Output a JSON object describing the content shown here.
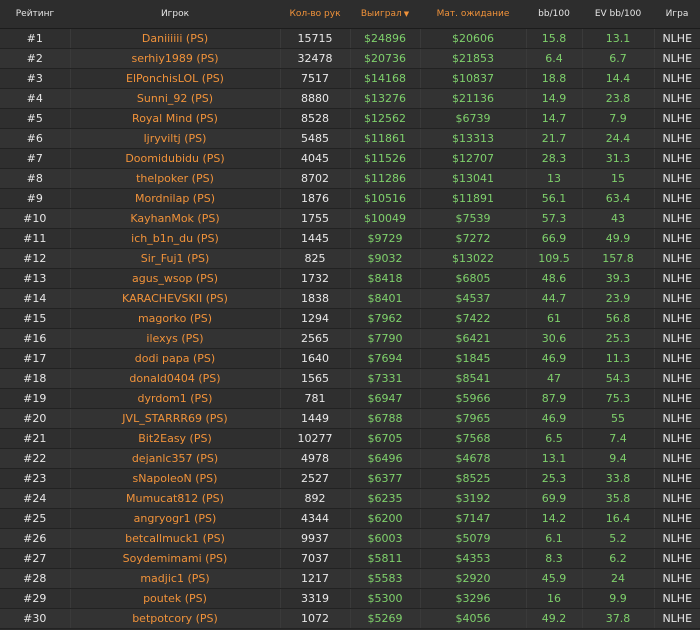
{
  "headers": {
    "rank": "Рейтинг",
    "player": "Игрок",
    "hands": "Кол-во рук",
    "won": "Выиграл",
    "won_arrow": "▼",
    "ev": "Мат. ожидание",
    "bb100": "bb/100",
    "evbb100": "EV bb/100",
    "game": "Игра"
  },
  "colors": {
    "accent": "#f0923a",
    "positive": "#7fd16c",
    "text": "#e8e8e8",
    "background": "#2b2b2b"
  },
  "rows": [
    {
      "rank": "#1",
      "player": "Daniiiiii (PS)",
      "hands": "15715",
      "won": "$24896",
      "ev": "$20606",
      "bb": "15.8",
      "evbb": "13.1",
      "game": "NLHE"
    },
    {
      "rank": "#2",
      "player": "serhiy1989 (PS)",
      "hands": "32478",
      "won": "$20736",
      "ev": "$21853",
      "bb": "6.4",
      "evbb": "6.7",
      "game": "NLHE"
    },
    {
      "rank": "#3",
      "player": "ElPonchisLOL (PS)",
      "hands": "7517",
      "won": "$14168",
      "ev": "$10837",
      "bb": "18.8",
      "evbb": "14.4",
      "game": "NLHE"
    },
    {
      "rank": "#4",
      "player": "Sunni_92 (PS)",
      "hands": "8880",
      "won": "$13276",
      "ev": "$21136",
      "bb": "14.9",
      "evbb": "23.8",
      "game": "NLHE"
    },
    {
      "rank": "#5",
      "player": "Royal Mind (PS)",
      "hands": "8528",
      "won": "$12562",
      "ev": "$6739",
      "bb": "14.7",
      "evbb": "7.9",
      "game": "NLHE"
    },
    {
      "rank": "#6",
      "player": "ljryviltj (PS)",
      "hands": "5485",
      "won": "$11861",
      "ev": "$13313",
      "bb": "21.7",
      "evbb": "24.4",
      "game": "NLHE"
    },
    {
      "rank": "#7",
      "player": "Doomidubidu (PS)",
      "hands": "4045",
      "won": "$11526",
      "ev": "$12707",
      "bb": "28.3",
      "evbb": "31.3",
      "game": "NLHE"
    },
    {
      "rank": "#8",
      "player": "thelpoker (PS)",
      "hands": "8702",
      "won": "$11286",
      "ev": "$13041",
      "bb": "13",
      "evbb": "15",
      "game": "NLHE"
    },
    {
      "rank": "#9",
      "player": "Mordnilap (PS)",
      "hands": "1876",
      "won": "$10516",
      "ev": "$11891",
      "bb": "56.1",
      "evbb": "63.4",
      "game": "NLHE"
    },
    {
      "rank": "#10",
      "player": "KayhanMok (PS)",
      "hands": "1755",
      "won": "$10049",
      "ev": "$7539",
      "bb": "57.3",
      "evbb": "43",
      "game": "NLHE"
    },
    {
      "rank": "#11",
      "player": "ich_b1n_du (PS)",
      "hands": "1445",
      "won": "$9729",
      "ev": "$7272",
      "bb": "66.9",
      "evbb": "49.9",
      "game": "NLHE"
    },
    {
      "rank": "#12",
      "player": "Sir_Fuj1 (PS)",
      "hands": "825",
      "won": "$9032",
      "ev": "$13022",
      "bb": "109.5",
      "evbb": "157.8",
      "game": "NLHE"
    },
    {
      "rank": "#13",
      "player": "agus_wsop (PS)",
      "hands": "1732",
      "won": "$8418",
      "ev": "$6805",
      "bb": "48.6",
      "evbb": "39.3",
      "game": "NLHE"
    },
    {
      "rank": "#14",
      "player": "KARACHEVSKII (PS)",
      "hands": "1838",
      "won": "$8401",
      "ev": "$4537",
      "bb": "44.7",
      "evbb": "23.9",
      "game": "NLHE"
    },
    {
      "rank": "#15",
      "player": "magorko (PS)",
      "hands": "1294",
      "won": "$7962",
      "ev": "$7422",
      "bb": "61",
      "evbb": "56.8",
      "game": "NLHE"
    },
    {
      "rank": "#16",
      "player": "ilexys (PS)",
      "hands": "2565",
      "won": "$7790",
      "ev": "$6421",
      "bb": "30.6",
      "evbb": "25.3",
      "game": "NLHE"
    },
    {
      "rank": "#17",
      "player": "dodi papa (PS)",
      "hands": "1640",
      "won": "$7694",
      "ev": "$1845",
      "bb": "46.9",
      "evbb": "11.3",
      "game": "NLHE"
    },
    {
      "rank": "#18",
      "player": "donald0404 (PS)",
      "hands": "1565",
      "won": "$7331",
      "ev": "$8541",
      "bb": "47",
      "evbb": "54.3",
      "game": "NLHE"
    },
    {
      "rank": "#19",
      "player": "dyrdom1 (PS)",
      "hands": "781",
      "won": "$6947",
      "ev": "$5966",
      "bb": "87.9",
      "evbb": "75.3",
      "game": "NLHE"
    },
    {
      "rank": "#20",
      "player": "JVL_STARRR69 (PS)",
      "hands": "1449",
      "won": "$6788",
      "ev": "$7965",
      "bb": "46.9",
      "evbb": "55",
      "game": "NLHE"
    },
    {
      "rank": "#21",
      "player": "Bit2Easy (PS)",
      "hands": "10277",
      "won": "$6705",
      "ev": "$7568",
      "bb": "6.5",
      "evbb": "7.4",
      "game": "NLHE"
    },
    {
      "rank": "#22",
      "player": "dejanlc357 (PS)",
      "hands": "4978",
      "won": "$6496",
      "ev": "$4678",
      "bb": "13.1",
      "evbb": "9.4",
      "game": "NLHE"
    },
    {
      "rank": "#23",
      "player": "sNapoleoN (PS)",
      "hands": "2527",
      "won": "$6377",
      "ev": "$8525",
      "bb": "25.3",
      "evbb": "33.8",
      "game": "NLHE"
    },
    {
      "rank": "#24",
      "player": "Mumucat812 (PS)",
      "hands": "892",
      "won": "$6235",
      "ev": "$3192",
      "bb": "69.9",
      "evbb": "35.8",
      "game": "NLHE"
    },
    {
      "rank": "#25",
      "player": "angryogr1 (PS)",
      "hands": "4344",
      "won": "$6200",
      "ev": "$7147",
      "bb": "14.2",
      "evbb": "16.4",
      "game": "NLHE"
    },
    {
      "rank": "#26",
      "player": "betcallmuck1 (PS)",
      "hands": "9937",
      "won": "$6003",
      "ev": "$5079",
      "bb": "6.1",
      "evbb": "5.2",
      "game": "NLHE"
    },
    {
      "rank": "#27",
      "player": "Soydemimami (PS)",
      "hands": "7037",
      "won": "$5811",
      "ev": "$4353",
      "bb": "8.3",
      "evbb": "6.2",
      "game": "NLHE"
    },
    {
      "rank": "#28",
      "player": "madjic1 (PS)",
      "hands": "1217",
      "won": "$5583",
      "ev": "$2920",
      "bb": "45.9",
      "evbb": "24",
      "game": "NLHE"
    },
    {
      "rank": "#29",
      "player": "poutek (PS)",
      "hands": "3319",
      "won": "$5300",
      "ev": "$3296",
      "bb": "16",
      "evbb": "9.9",
      "game": "NLHE"
    },
    {
      "rank": "#30",
      "player": "betpotcory (PS)",
      "hands": "1072",
      "won": "$5269",
      "ev": "$4056",
      "bb": "49.2",
      "evbb": "37.8",
      "game": "NLHE"
    }
  ]
}
